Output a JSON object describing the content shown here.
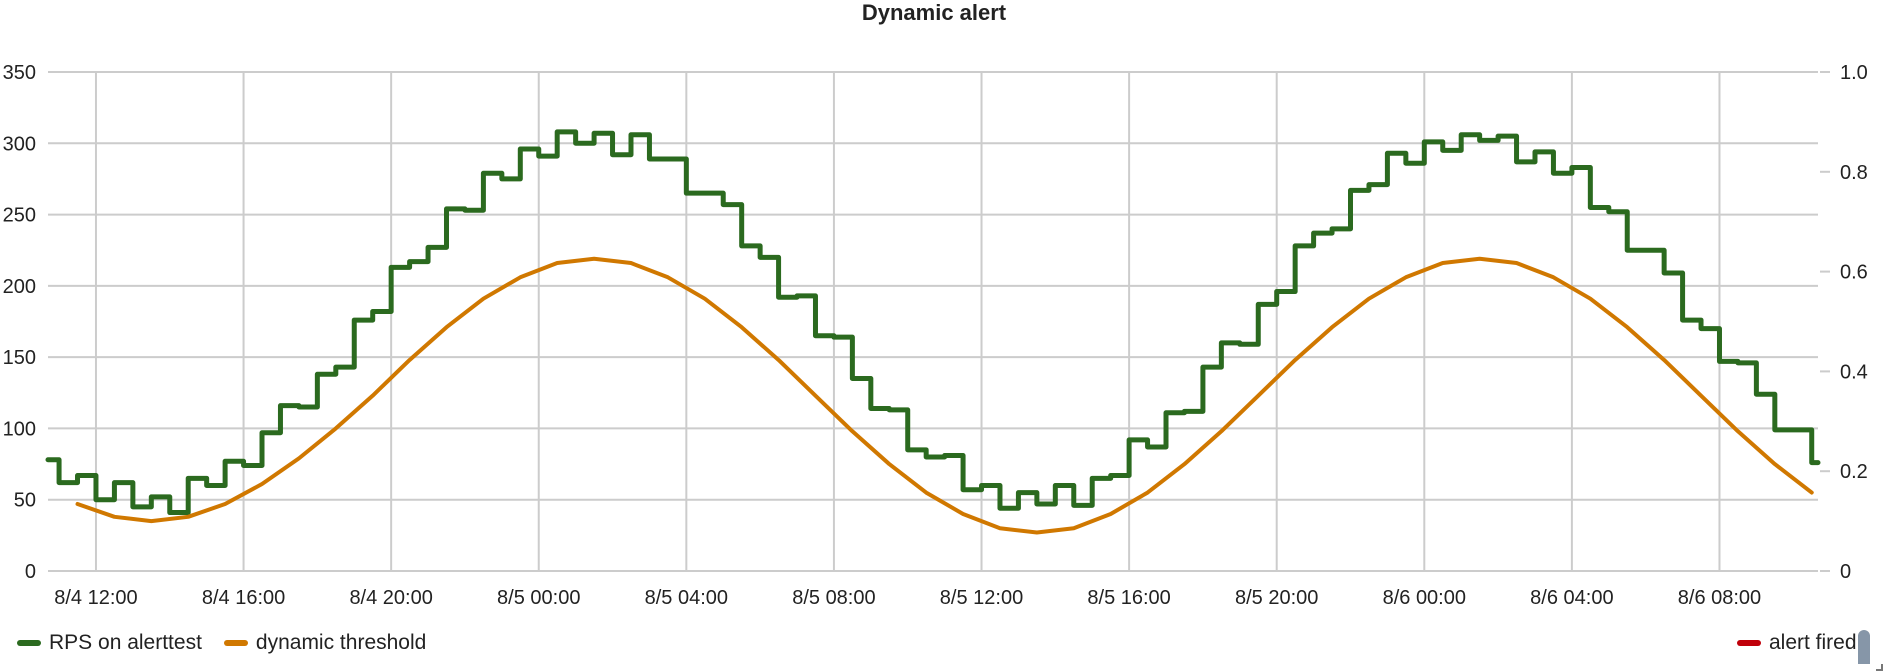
{
  "chart_data": {
    "type": "line",
    "title": "Dynamic alert",
    "xlabel": "",
    "ylabel": "",
    "x_unit": "hours since 8/4 00:00",
    "xlim": [
      10.7,
      58.67
    ],
    "ylim": [
      0,
      350
    ],
    "y2lim": [
      0,
      1.0
    ],
    "grid": true,
    "legend_position": "bottom",
    "yticks": [
      "0",
      "50",
      "100",
      "150",
      "200",
      "250",
      "300",
      "350"
    ],
    "ytick_values": [
      0,
      50,
      100,
      150,
      200,
      250,
      300,
      350
    ],
    "y2ticks": [
      "0",
      "0.2",
      "0.4",
      "0.6",
      "0.8",
      "1.0"
    ],
    "y2tick_values": [
      0,
      0.2,
      0.4,
      0.6,
      0.8,
      1.0
    ],
    "xticks": [
      "8/4 12:00",
      "8/4 16:00",
      "8/4 20:00",
      "8/5 00:00",
      "8/5 04:00",
      "8/5 08:00",
      "8/5 12:00",
      "8/5 16:00",
      "8/5 20:00",
      "8/6 00:00",
      "8/6 04:00",
      "8/6 08:00"
    ],
    "xtick_values": [
      12,
      16,
      20,
      24,
      28,
      32,
      36,
      40,
      44,
      48,
      52,
      56
    ],
    "series": [
      {
        "name": "RPS on alerttest",
        "color": "#2b6a1f",
        "style": "step",
        "axis": "left",
        "x_start": 10.5,
        "x_step": 0.5,
        "values": [
          78,
          62,
          67,
          50,
          62,
          45,
          52,
          41,
          65,
          60,
          77,
          74,
          97,
          116,
          115,
          138,
          143,
          176,
          182,
          213,
          217,
          227,
          254,
          253,
          279,
          275,
          296,
          291,
          308,
          300,
          307,
          292,
          306,
          289,
          289,
          265,
          265,
          257,
          228,
          220,
          192,
          193,
          165,
          164,
          135,
          114,
          113,
          85,
          80,
          81,
          57,
          60,
          44,
          55,
          47,
          60,
          46,
          65,
          67,
          92,
          87,
          111,
          112,
          143,
          160,
          159,
          187,
          196,
          228,
          237,
          240,
          267,
          271,
          293,
          286,
          301,
          295,
          306,
          302,
          305,
          287,
          294,
          279,
          283,
          255,
          252,
          225,
          225,
          209,
          176,
          170,
          147,
          146,
          124,
          99,
          99,
          76
        ]
      },
      {
        "name": "dynamic threshold",
        "color": "#d07800",
        "style": "line",
        "axis": "left",
        "x_start": 11.5,
        "x_step": 1,
        "values": [
          47,
          38,
          35,
          38,
          47,
          61,
          79,
          100,
          123,
          148,
          171,
          191,
          206,
          216,
          219,
          216,
          206,
          191,
          171,
          148,
          123,
          98,
          75,
          55,
          40,
          30,
          27,
          30,
          40,
          55,
          75,
          98,
          123,
          148,
          171,
          191,
          206,
          216,
          219,
          216,
          206,
          191,
          171,
          148,
          123,
          98,
          75,
          55
        ]
      },
      {
        "name": "alert fired",
        "color": "#c0000a",
        "style": "line",
        "axis": "right",
        "values": []
      }
    ]
  }
}
